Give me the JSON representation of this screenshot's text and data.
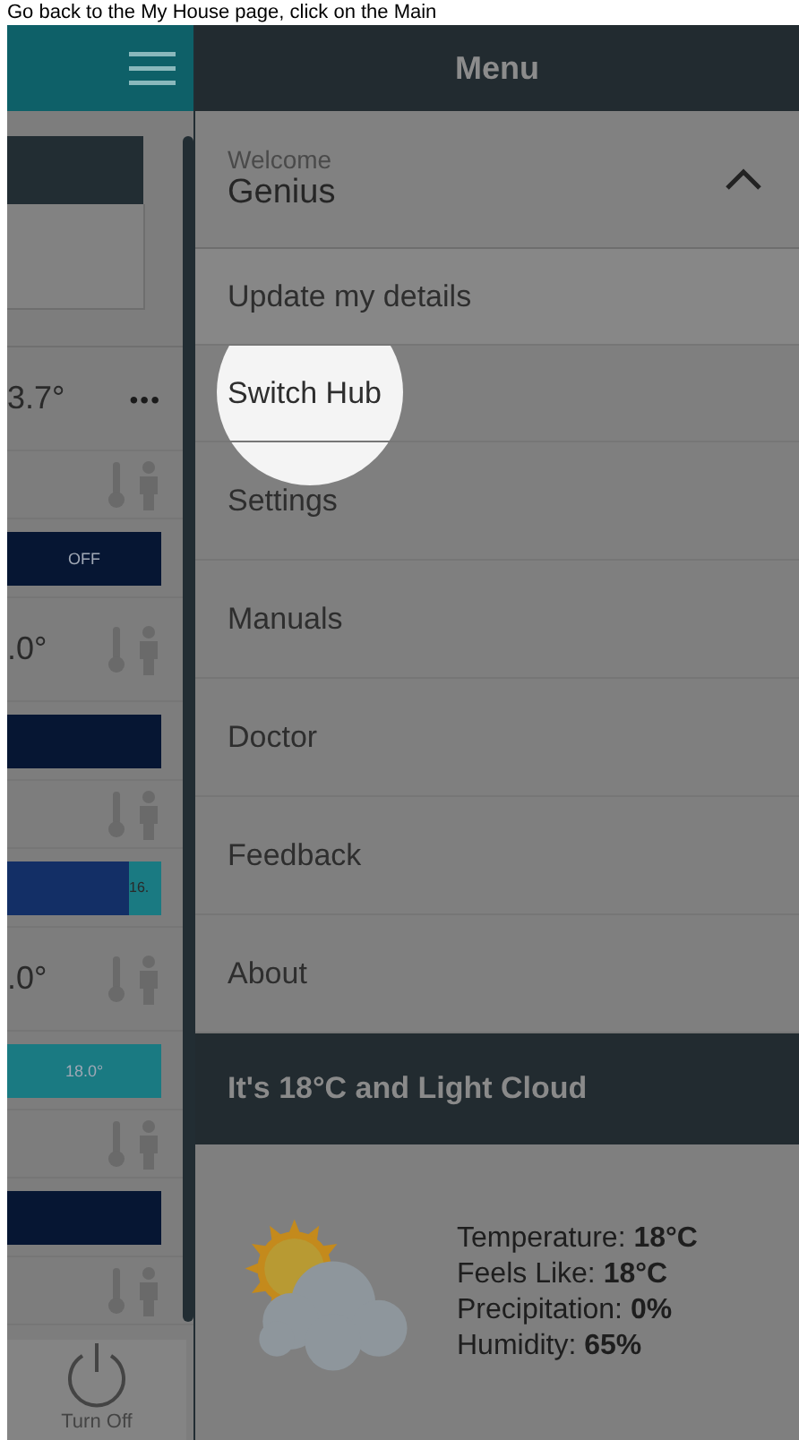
{
  "caption": "Go back to the My House page, click on the Main",
  "left_panel": {
    "rows": [
      {
        "kind": "reading",
        "text": "3.7°",
        "menu": "•••"
      },
      {
        "kind": "icons"
      },
      {
        "kind": "bar",
        "color": "#061633",
        "text": "OFF"
      },
      {
        "kind": "reading",
        "text": ".0°"
      },
      {
        "kind": "bar",
        "color": "#061633"
      },
      {
        "kind": "icons"
      },
      {
        "kind": "split",
        "color": "#132f66",
        "text": "16."
      },
      {
        "kind": "reading",
        "text": ".0°"
      },
      {
        "kind": "bar",
        "color": "#1a7a82",
        "text": "18.0°"
      },
      {
        "kind": "icons"
      },
      {
        "kind": "bar",
        "color": "#061633"
      },
      {
        "kind": "icons"
      }
    ],
    "turn_off": "Turn Off"
  },
  "menu": {
    "title": "Menu",
    "welcome": "Welcome",
    "user": "Genius",
    "expanded": true,
    "items": [
      {
        "label": "Update my details",
        "selected": false
      },
      {
        "label": "Switch Hub",
        "selected": true
      },
      {
        "label": "Settings",
        "selected": false
      },
      {
        "label": "Manuals",
        "selected": false
      },
      {
        "label": "Doctor",
        "selected": false
      },
      {
        "label": "Feedback",
        "selected": false
      },
      {
        "label": "About",
        "selected": false
      }
    ]
  },
  "weather": {
    "headline": "It's 18°C and Light Cloud",
    "details": [
      {
        "label": "Temperature:",
        "value": "18°C"
      },
      {
        "label": "Feels Like:",
        "value": "18°C"
      },
      {
        "label": "Precipitation:",
        "value": "0%"
      },
      {
        "label": "Humidity:",
        "value": "65%"
      }
    ]
  }
}
